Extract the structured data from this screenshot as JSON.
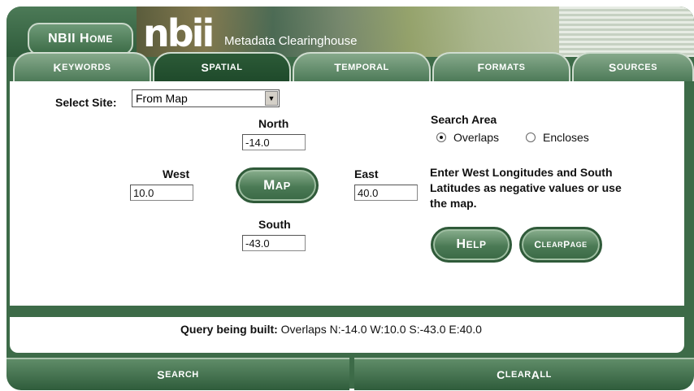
{
  "header": {
    "home_first": "NBII H",
    "home_rest": "OME",
    "logo_text": "nbii",
    "subtitle": "Metadata Clearinghouse"
  },
  "tabs": [
    {
      "first": "K",
      "rest": "EYWORDS"
    },
    {
      "first": "S",
      "rest": "PATIAL"
    },
    {
      "first": "T",
      "rest": "EMPORAL"
    },
    {
      "first": "F",
      "rest": "ORMATS"
    },
    {
      "first": "S",
      "rest": "OURCES"
    }
  ],
  "spatial": {
    "select_label": "Select Site:",
    "select_value": "From Map",
    "north_label": "North",
    "north_value": "-14.0",
    "west_label": "West",
    "west_value": "10.0",
    "east_label": "East",
    "east_value": "40.0",
    "south_label": "South",
    "south_value": "-43.0",
    "map_first": "M",
    "map_rest": "AP",
    "search_area_label": "Search Area",
    "overlaps_label": "Overlaps",
    "encloses_label": "Encloses",
    "selected_area": "Overlaps",
    "instructions": "Enter West Longitudes and South Latitudes as negative values or use the map.",
    "help_first": "H",
    "help_rest": "ELP",
    "clear_page_first": "C",
    "clear_page_mid": "LEAR ",
    "clear_page_p": "P",
    "clear_page_rest": "AGE"
  },
  "query": {
    "label": "Query being built:",
    "value": "Overlaps N:-14.0 W:10.0 S:-43.0 E:40.0"
  },
  "bottom": {
    "search_first": "S",
    "search_rest": "EARCH",
    "clear_all_first": "C",
    "clear_all_rest": "LEAR ",
    "clear_all_a": "A",
    "clear_all_a_rest": "LL"
  }
}
